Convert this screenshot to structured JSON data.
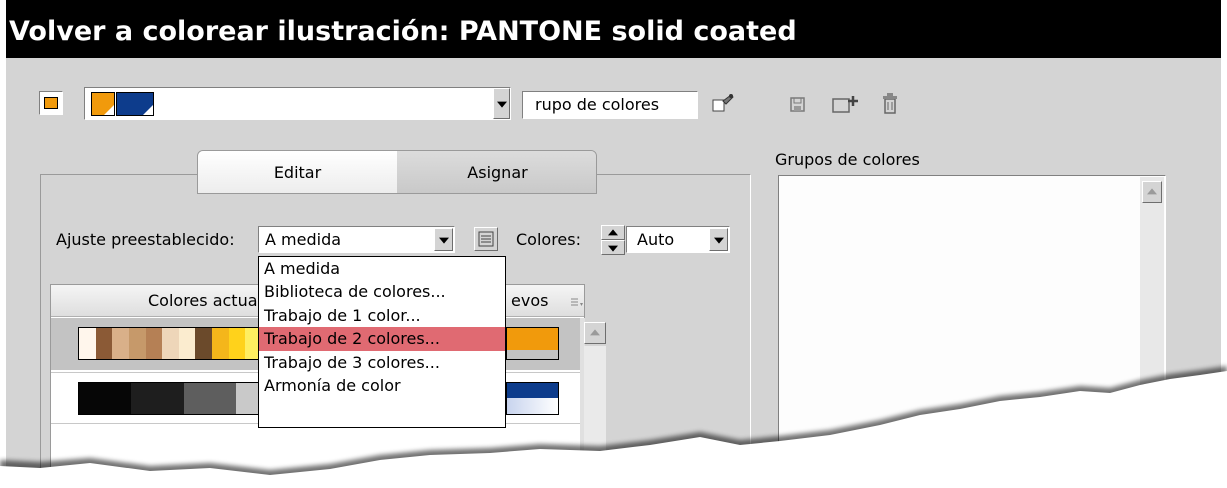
{
  "window": {
    "title": "Volver a colorear ilustración: PANTONE solid coated"
  },
  "toolbar": {
    "group_name_value": "rupo de colores",
    "icons": [
      "color-swatch-icon",
      "harmony-icon",
      "eyedropper-icon",
      "save-icon",
      "new-group-icon",
      "delete-icon"
    ]
  },
  "tabs": {
    "edit": "Editar",
    "assign": "Asignar",
    "active": "assign"
  },
  "preset": {
    "label": "Ajuste preestablecido:",
    "value": "A medida",
    "options": [
      "A medida",
      "Biblioteca de colores...",
      "Trabajo de 1 color...",
      "Trabajo de 2 colores...",
      "Trabajo de 3 colores...",
      "Armonía de color"
    ],
    "highlighted": "Trabajo de 2 colores..."
  },
  "colors": {
    "label": "Colores:",
    "value": "Auto"
  },
  "table": {
    "col_current": "Colores actua",
    "col_new": "evos",
    "menu_icon": "list-menu-icon",
    "row1_swatches": [
      "#fff6ec",
      "#8b5a36",
      "#d9b089",
      "#c6996a",
      "#b58055",
      "#eed6b9",
      "#fbeccf",
      "#6b4a2b",
      "#f4b61b",
      "#ffd21b",
      "#ffee60"
    ],
    "row2_swatches": [
      "#060606",
      "#060606",
      "#1e1e1e",
      "#1e1e1e",
      "#5e5e5e",
      "#5e5e5e",
      "#c9c9c9"
    ],
    "row1_new": "#f19a0c",
    "row2_new": "#0d3c8c"
  },
  "groups": {
    "label": "Grupos de colores"
  },
  "accent": {
    "orange": "#f19a0c",
    "blue": "#0d3c8c",
    "highlight": "#e06a72"
  }
}
